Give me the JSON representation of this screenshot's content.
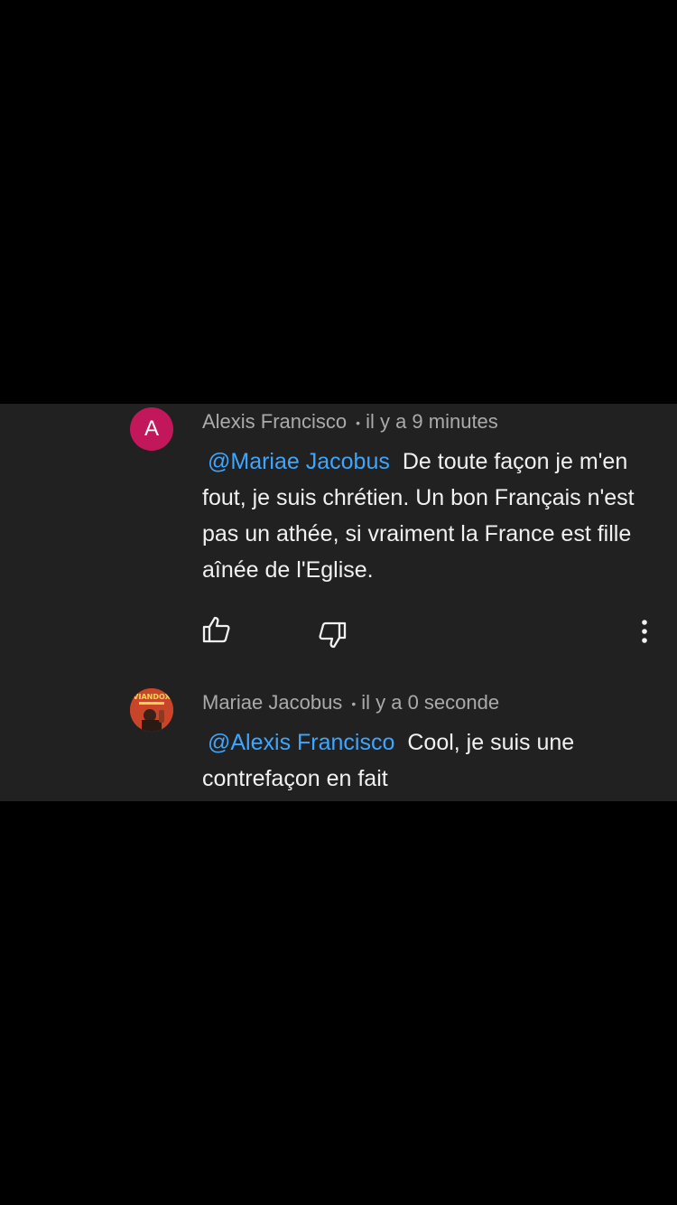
{
  "comments": [
    {
      "avatar_letter": "A",
      "author": "Alexis Francisco",
      "separator": "•",
      "time": "il y a 9 minutes",
      "mention": "@Mariae Jacobus",
      "text": "De toute façon je m'en fout, je suis chrétien. Un bon Français n'est pas un athée, si vraiment la France est fille aînée de l'Eglise."
    },
    {
      "avatar_logo": "VIANDOX",
      "author": "Mariae Jacobus",
      "separator": "•",
      "time": "il y a 0 seconde",
      "mention": "@Alexis Francisco",
      "text": "Cool, je suis une contrefaçon en fait"
    }
  ],
  "actions": {
    "like_icon": "thumbs-up-icon",
    "dislike_icon": "thumbs-down-icon",
    "more_icon": "more-vert-icon"
  },
  "colors": {
    "panel_bg": "#212121",
    "mention": "#3ea6ff",
    "avatar_a": "#c2185b",
    "meta_text": "#aaaaaa"
  }
}
